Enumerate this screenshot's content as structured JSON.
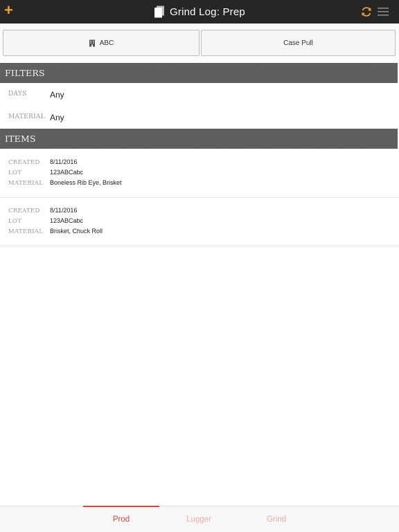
{
  "header": {
    "title": "Grind Log: Prep",
    "add_label": "+",
    "icons": {
      "add": "plus-icon",
      "title": "document-icon",
      "refresh": "refresh-icon",
      "menu": "hamburger-menu-icon"
    },
    "accent_color": "#f0a02a"
  },
  "segments": {
    "abc_label": "ABC",
    "case_pull_label": "Case Pull",
    "abc_icon": "building-icon"
  },
  "filters": {
    "header": "FILTERS",
    "days_label": "DAYS",
    "days_value": "Any",
    "material_label": "MATERIAL",
    "material_value": "Any"
  },
  "items_section": {
    "header": "ITEMS",
    "created_label": "CREATED",
    "lot_label": "LOT",
    "material_label": "MATERIAL",
    "items": [
      {
        "created": "8/11/2016",
        "lot": "123ABCabc",
        "material": "Boneless Rib Eye, Brisket"
      },
      {
        "created": "8/11/2016",
        "lot": "123ABCabc",
        "material": "Brisket, Chuck Roll"
      }
    ]
  },
  "tabs": {
    "prod": "Prod",
    "lugger": "Lugger",
    "grind": "Grind",
    "active": "Prod",
    "active_color": "#d9473f",
    "inactive_color": "#efafa6"
  }
}
